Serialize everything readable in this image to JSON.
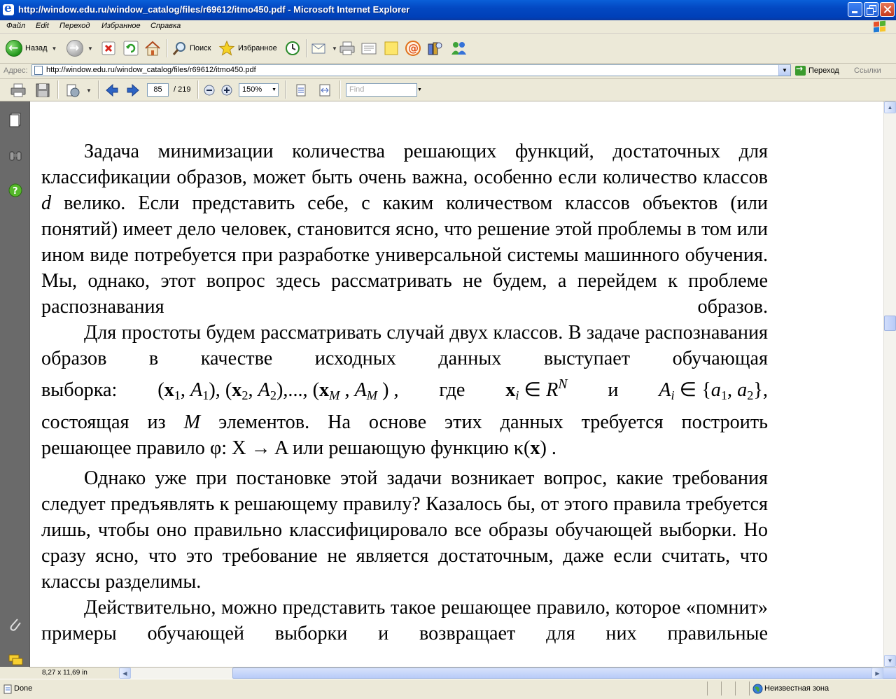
{
  "window": {
    "title": "http://window.edu.ru/window_catalog/files/r69612/itmo450.pdf - Microsoft Internet Explorer"
  },
  "menu": [
    "Файл",
    "Edit",
    "Переход",
    "Избранное",
    "Справка"
  ],
  "toolbar": {
    "back_label": "Назад",
    "search_label": "Поиск",
    "favorites_label": "Избранное"
  },
  "address": {
    "label": "Адрес:",
    "url": "http://window.edu.ru/window_catalog/files/r69612/itmo450.pdf",
    "go_label": "Переход",
    "links_label": "Ссылки"
  },
  "pdf_toolbar": {
    "current_page": "85",
    "total_pages": "/ 219",
    "zoom": "150%",
    "find_placeholder": "Find"
  },
  "document": {
    "paragraphs": [
      "Задача минимизации количества решающих функций, достаточных для классификации образов, может быть очень важна, особенно если количество классов",
      "велико. Если представить себе, с каким количеством классов объектов (или понятий) имеет дело человек, становится ясно, что решение этой проблемы в том или ином виде потребуется при разработке универсальной системы машинного обучения. Мы, однако, этот вопрос здесь рассматривать не будем, а перейдем к проблеме распознавания образов.",
      "Для простоты будем рассматривать случай двух классов. В задаче распознавания образов в качестве исходных данных выступает обучающая",
      "выборка:",
      "где",
      "и",
      "состоящая из",
      "элементов. На основе этих данных требуется построить",
      "решающее правило",
      "или решающую функцию",
      "Однако уже при постановке этой задачи возникает вопрос, какие требования следует предъявлять к решающему правилу? Казалось бы, от этого правила требуется лишь, чтобы оно правильно классифицировало все образы обучающей выборки. Но сразу ясно, что это требование не является достаточным, даже если считать, что классы разделимы.",
      "Действительно, можно представить такое решающее правило, которое «помнит» примеры обучающей выборки и возвращает для них правильные"
    ],
    "var_d": "d",
    "var_M": "M"
  },
  "pagesize": "8,27 x 11,69 in",
  "status": {
    "done": "Done",
    "zone": "Неизвестная зона"
  }
}
